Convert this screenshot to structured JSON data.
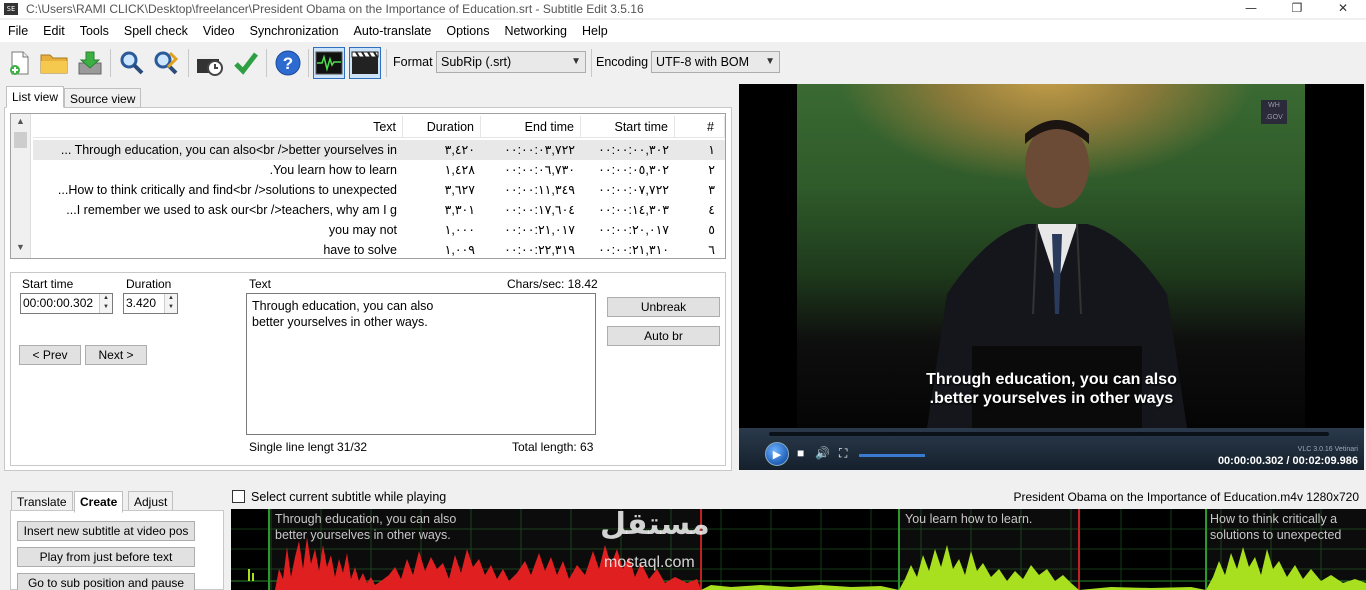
{
  "window": {
    "title": "C:\\Users\\RAMI CLICK\\Desktop\\freelancer\\President Obama on the Importance of Education.srt - Subtitle Edit 3.5.16",
    "icon_label": "SE",
    "minimize": "—",
    "restore": "❐",
    "close": "✕"
  },
  "menu": [
    "File",
    "Edit",
    "Tools",
    "Spell check",
    "Video",
    "Synchronization",
    "Auto-translate",
    "Options",
    "Networking",
    "Help"
  ],
  "toolbar": {
    "format_label": "Format",
    "format_value": "SubRip (.srt)",
    "encoding_label": "Encoding",
    "encoding_value": "UTF-8 with BOM"
  },
  "view_tabs": [
    "List view",
    "Source view"
  ],
  "table": {
    "headers": {
      "text": "Text",
      "duration": "Duration",
      "end": "End time",
      "start": "Start time",
      "num": "#"
    },
    "rows": [
      {
        "text": "... Through education, you can also<br />better yourselves in",
        "duration": "٣,٤٢٠",
        "end": "٠٠:٠٠:٠٣,٧٢٢",
        "start": "٠٠:٠٠:٠٠,٣٠٢",
        "num": "١"
      },
      {
        "text": ".You learn how to learn",
        "duration": "١,٤٢٨",
        "end": "٠٠:٠٠:٠٦,٧٣٠",
        "start": "٠٠:٠٠:٠٥,٣٠٢",
        "num": "٢"
      },
      {
        "text": "...How to think critically and find<br />solutions to unexpected",
        "duration": "٣,٦٢٧",
        "end": "٠٠:٠٠:١١,٣٤٩",
        "start": "٠٠:٠٠:٠٧,٧٢٢",
        "num": "٣"
      },
      {
        "text": "...I remember we used to ask our<br />teachers, why am I g",
        "duration": "٣,٣٠١",
        "end": "٠٠:٠٠:١٧,٦٠٤",
        "start": "٠٠:٠٠:١٤,٣٠٣",
        "num": "٤"
      },
      {
        "text": "you may not",
        "duration": "١,٠٠٠",
        "end": "٠٠:٠٠:٢١,٠١٧",
        "start": "٠٠:٠٠:٢٠,٠١٧",
        "num": "٥"
      },
      {
        "text": "have to solve",
        "duration": "١,٠٠٩",
        "end": "٠٠:٠٠:٢٢,٣١٩",
        "start": "٠٠:٠٠:٢١,٣١٠",
        "num": "٦"
      }
    ]
  },
  "edit": {
    "start_time_label": "Start time",
    "start_time_value": "00:00:00.302",
    "duration_label": "Duration",
    "duration_value": "3.420",
    "text_label": "Text",
    "chars_sec": "Chars/sec: 18.42",
    "text_line1": "Through education, you can also",
    "text_line2": "better yourselves in other ways.",
    "prev": "< Prev",
    "next": "Next >",
    "unbreak": "Unbreak",
    "auto_br": "Auto br",
    "single_line": "Single line lengt 31/32",
    "total_length": "Total length: 63"
  },
  "video": {
    "subtitle_line1": "Through education, you can also",
    "subtitle_line2": ".better yourselves in other ways",
    "logo_text": "WH .GOV",
    "vlc_version": "VLC 3.0.16 Vetinari",
    "time": "00:00:00.302 / 00:02:09.986"
  },
  "bottom": {
    "tabs": [
      "Translate",
      "Create",
      "Adjust"
    ],
    "buttons": [
      "Insert new subtitle at video pos",
      "Play from just before text",
      "Go to sub position and pause"
    ],
    "checkbox_label": "Select current subtitle while playing",
    "video_info": "President Obama on the Importance of Education.m4v 1280x720"
  },
  "waveform": {
    "seg1_line1": "Through education, you can also",
    "seg1_line2": "better yourselves in other ways.",
    "seg2_line1": "You learn how to learn.",
    "seg3_line1": "How to think critically a",
    "seg3_line2": "solutions to unexpected",
    "watermark_ar": "مستقل",
    "watermark_en": "mostaql.com",
    "colors": {
      "selected": "#e02020",
      "other": "#a8e020",
      "grid": "#1a3a1a"
    }
  }
}
